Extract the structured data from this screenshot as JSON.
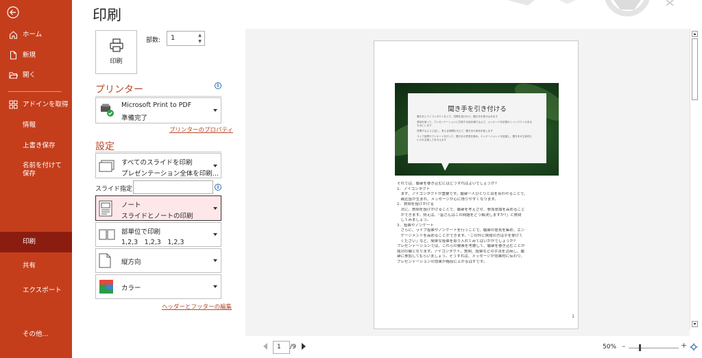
{
  "sidebar": {
    "items": [
      {
        "label": "ホーム"
      },
      {
        "label": "新規"
      },
      {
        "label": "開く"
      },
      {
        "label": "アドインを取得"
      },
      {
        "label": "情報"
      },
      {
        "label": "上書き保存"
      },
      {
        "label": "名前を付けて保存"
      },
      {
        "label": "印刷"
      },
      {
        "label": "共有"
      },
      {
        "label": "エクスポート"
      },
      {
        "label": "その他..."
      }
    ]
  },
  "page_title": "印刷",
  "print_button": {
    "label": "印刷"
  },
  "copies": {
    "label": "部数:",
    "value": "1"
  },
  "printer": {
    "heading": "プリンター",
    "name": "Microsoft Print to PDF",
    "status": "準備完了",
    "properties_link": "プリンターのプロパティ"
  },
  "settings": {
    "heading": "設定",
    "range": {
      "line1": "すべてのスライドを印刷",
      "line2": "プレゼンテーション全体を印刷..."
    },
    "slides_label": "スライド指定:",
    "slides_value": "",
    "layout": {
      "line1": "ノート",
      "line2": "スライドとノートの印刷"
    },
    "collate": {
      "line1": "部単位で印刷",
      "line2": "1,2,3　1,2,3　1,2,3"
    },
    "orientation": {
      "line1": "縦方向"
    },
    "color": {
      "line1": "カラー"
    },
    "header_footer_link": "ヘッダーとフッターの編集"
  },
  "preview": {
    "slide_title": "聞き手を引き付ける",
    "slide_lines": [
      "聞き手とアイコンタクトをとり、質問を投げかけ、聞き手を巻き込みます",
      "書話を使って、プレゼンテーションに共感する話を織り込んで、メッセージを記憶のくインパクトのある",
      "ものにします",
      "質問するように話し、考える時間を与えて、聞き手の参加を促します",
      "ライブ投票やアンケートを行って、聞き手の意見を集め、エンゲージメントを促進し、聞き手が主体的に",
      "いられる楽しさを与えます"
    ],
    "notes_lines": [
      "それでは、聴衆を巻き込むにはどうすればよいでしょうか?",
      "1. アイコンタクト",
      "　まず、アイコンタクトが重要です。聴衆一人ひとりと目を合わせることで、",
      "　親近感が生まれ、メッセージが心に残りやすくなります。",
      "2. 質問を投げかける",
      "　次に、質問を投げかけることで、聴衆を考えさせ、参加意識を高めること",
      "　ができます。例えば、「皆さんはこの問題をどう解決しますか?」と質問",
      "　してみましょう。",
      "3. 投票やアンケート",
      "　さらに、ライブ投票やアンケートを行うことで、聴衆の意見を集め、エン",
      "　ゲージメントを高めることができます。「この件に賛成の方は手を挙げて",
      "　ください」など、簡単な投票を取り入れてみてはいかがでしょうか?",
      "プレゼンテーションでは、これらの要素を考慮して、聴衆を巻き込むことが",
      "成功の鍵となります。アイコンタクト、質問、投票などの手法を活用し、聴",
      "衆に参加してもらいましょう。そうすれば、メッセージが効果的に伝わり、",
      "プレゼンテーションの効果が格段に上がるはずです。"
    ],
    "page_number": "1"
  },
  "pager": {
    "current": "1",
    "total": "/9"
  },
  "zoom": {
    "percent": "50%",
    "minus": "–",
    "plus": "+",
    "level": 0.5
  },
  "colors": {
    "accent": "#c43e1c",
    "accent_dark": "#8b1c10",
    "heading": "#b7472a",
    "selected_bg": "#fde7e9"
  }
}
